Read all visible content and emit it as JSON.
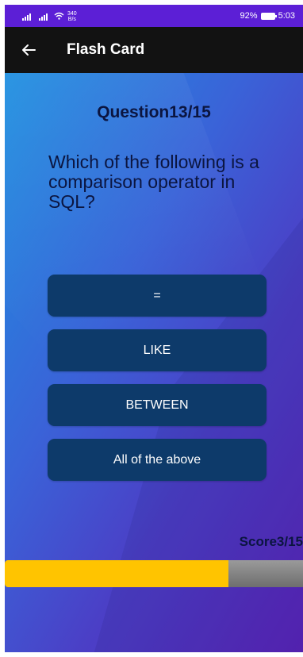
{
  "status_bar": {
    "speed_value": "340",
    "speed_unit": "B/s",
    "battery_percent": "92%",
    "time": "5:03"
  },
  "app_bar": {
    "title": "Flash Card",
    "back_icon": "arrow-left-icon"
  },
  "quiz": {
    "question_count": "Question13/15",
    "question": "Which of the following is a comparison operator in SQL?",
    "options": [
      "=",
      "LIKE",
      "BETWEEN",
      "All of the above"
    ],
    "score": "Score3/15",
    "progress": 0.75
  },
  "colors": {
    "status_bar": "#5c1fd6",
    "app_bar": "#121212",
    "option_bg": "#0d3a6a",
    "progress_fill": "#ffc400",
    "progress_track": "#808080"
  }
}
